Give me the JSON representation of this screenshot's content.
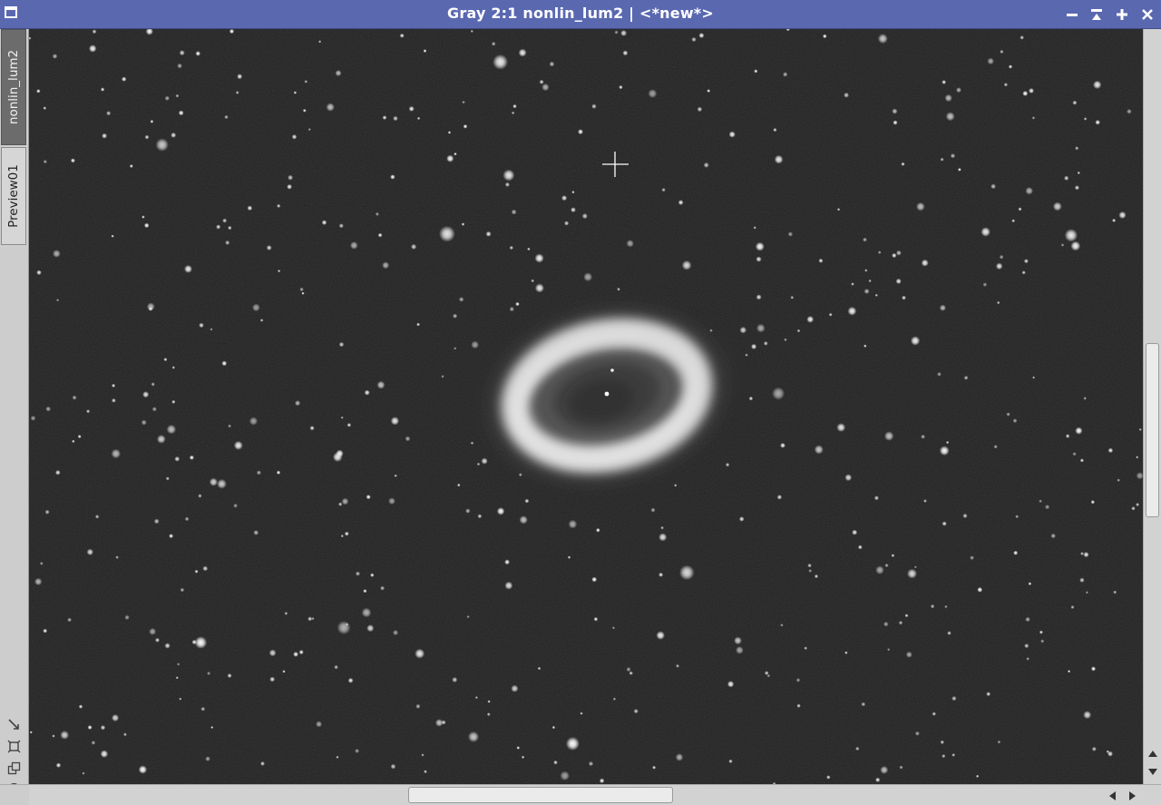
{
  "window": {
    "title_prefix": "Gray 2:1",
    "title_name": "nonlin_lum2",
    "title_sep": " | ",
    "title_state": "<*new*>"
  },
  "tabs": [
    {
      "label": "nonlin_lum2",
      "active": true
    },
    {
      "label": "Preview01",
      "active": false
    }
  ],
  "icons": {
    "app": "window-icon",
    "minimize": "minimize-icon",
    "shade": "shade-icon",
    "maximize": "maximize-icon",
    "close": "close-icon",
    "tools": [
      "fit-view-icon",
      "zoom-to-fit-icon",
      "clone-icon",
      "settings-icon"
    ],
    "scroll_up": "arrow-up-icon",
    "scroll_down": "arrow-down-icon",
    "scroll_left": "arrow-left-icon",
    "scroll_right": "arrow-right-icon",
    "cursor": "crosshair-icon"
  },
  "colors": {
    "titlebar": "#5a68b0",
    "image_background": "#1f1f1f",
    "nebula": "#d8d8d8"
  },
  "scroll": {
    "vertical_position": 0.42,
    "vertical_visible": 0.23,
    "horizontal_position": 0.34,
    "horizontal_visible": 0.24
  }
}
